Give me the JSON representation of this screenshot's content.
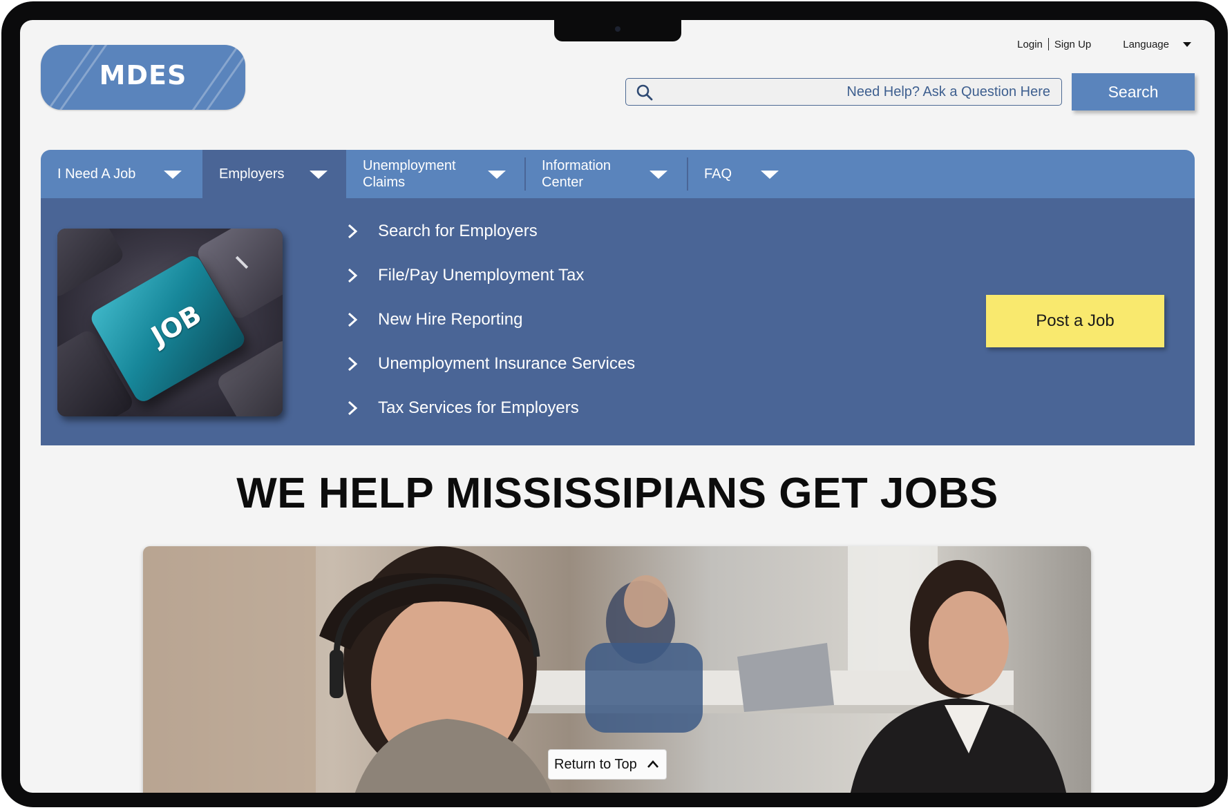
{
  "brand": {
    "logo_text": "MDES",
    "primary_color": "#5a84bc",
    "dark_color": "#4a6596",
    "accent_color": "#f9e96e"
  },
  "top_links": {
    "login": "Login",
    "signup": "Sign Up",
    "language": "Language"
  },
  "search": {
    "placeholder": "Need Help? Ask a Question Here",
    "value": "",
    "button_label": "Search",
    "icon": "search-icon"
  },
  "nav": {
    "items": [
      {
        "label": "I Need A Job",
        "active": false
      },
      {
        "label": "Employers",
        "active": true
      },
      {
        "label": "Unemployment Claims",
        "active": false
      },
      {
        "label": "Information Center",
        "active": false
      },
      {
        "label": "FAQ",
        "active": false
      }
    ]
  },
  "dropdown": {
    "image_label": "JOB",
    "links": [
      "Search for Employers",
      "File/Pay Unemployment Tax",
      "New Hire Reporting",
      "Unemployment Insurance Services",
      "Tax Services for Employers"
    ],
    "cta_label": "Post a Job"
  },
  "hero": {
    "headline": "WE HELP MISSISSIPIANS GET JOBS"
  },
  "return_to_top": {
    "label": "Return to Top",
    "icon": "chevron-up-icon"
  }
}
